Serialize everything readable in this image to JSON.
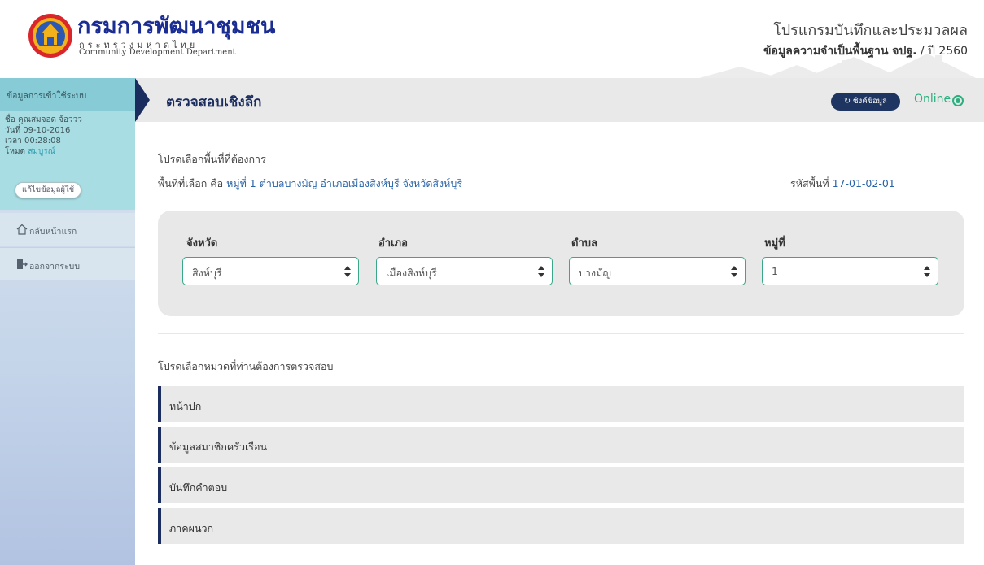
{
  "header": {
    "org_name_th": "กรมการพัฒนาชุมชน",
    "org_ministry_th": "กระทรวงมหาดไทย",
    "org_name_en": "Community Development Department",
    "program_title": "โปรแกรมบันทึกและประมวลผล",
    "program_subtitle_bold": "ข้อมูลความจำเป็นพื้นฐาน จปฐ.",
    "program_subtitle_rest": " / ปี 2560"
  },
  "sidebar": {
    "section_title": "ข้อมูลการเข้าใช้ระบบ",
    "user_name": "ชื่อ คุณสมจอด จ้อววว",
    "date": "วันที่ 09-10-2016",
    "time": "เวลา 00:28:08",
    "mode_label": "โหมด",
    "mode_value": "สมบูรณ์",
    "edit_user_label": "แก้ไขข้อมูลผู้ใช้",
    "items": [
      {
        "label": "กลับหน้าแรก",
        "icon": "home-icon"
      },
      {
        "label": "ออกจากระบบ",
        "icon": "logout-icon"
      }
    ]
  },
  "titlebar": {
    "title": "ตรวจสอบเชิงลึก",
    "sync_label": "ซิงค์ข้อมูล",
    "status_label": "Online",
    "status_color": "#2ab07f"
  },
  "main": {
    "select_area_prompt": "โปรดเลือกพื้นที่ที่ต้องการ",
    "selected_prefix": "พื้นที่ที่เลือก คือ ",
    "selected_value": "หมู่ที่ 1 ตำบลบางมัญ อำเภอเมืองสิงห์บุรี จังหวัดสิงห์บุรี",
    "area_code_prefix": "รหัสพื้นที่ ",
    "area_code_value": "17-01-02-01",
    "filters": [
      {
        "label": "จังหวัด",
        "value": "สิงห์บุรี"
      },
      {
        "label": "อำเภอ",
        "value": "เมืองสิงห์บุรี"
      },
      {
        "label": "ตำบล",
        "value": "บางมัญ"
      },
      {
        "label": "หมู่ที่",
        "value": "1"
      }
    ],
    "category_prompt": "โปรดเลือกหมวดที่ท่านต้องการตรวจสอบ",
    "categories": [
      "หน้าปก",
      "ข้อมูลสมาชิกครัวเรือน",
      "บันทึกคำตอบ",
      "ภาคผนวก"
    ]
  },
  "colors": {
    "accent_navy": "#1b2d5e",
    "sidebar_header": "#86cbd5",
    "select_border": "#3aa78a",
    "link_blue": "#2a64a8"
  }
}
